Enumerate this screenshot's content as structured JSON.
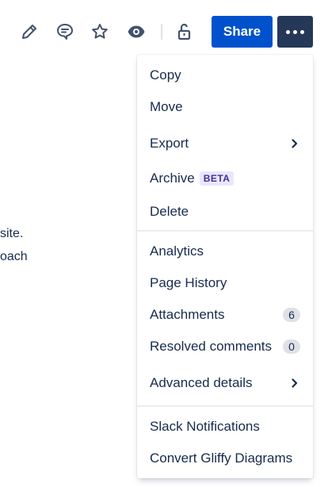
{
  "toolbar": {
    "icons": [
      "edit-icon",
      "comment-icon",
      "star-icon",
      "watch-icon",
      "unlock-icon"
    ],
    "share_label": "Share",
    "more_icon": "more-horizontal-icon",
    "accent_color": "#0052cc",
    "more_bg_color": "#253858"
  },
  "background_text": {
    "line1": "site.",
    "line2": "oach"
  },
  "menu": {
    "group1": {
      "copy": "Copy",
      "move": "Move",
      "export": "Export",
      "archive": "Archive",
      "archive_badge": "BETA",
      "delete": "Delete"
    },
    "group2": {
      "analytics": "Analytics",
      "page_history": "Page History",
      "attachments": "Attachments",
      "attachments_count": "6",
      "resolved_comments": "Resolved comments",
      "resolved_count": "0",
      "advanced_details": "Advanced details"
    },
    "group3": {
      "slack": "Slack Notifications",
      "gliffy": "Convert Gliffy Diagrams"
    }
  }
}
